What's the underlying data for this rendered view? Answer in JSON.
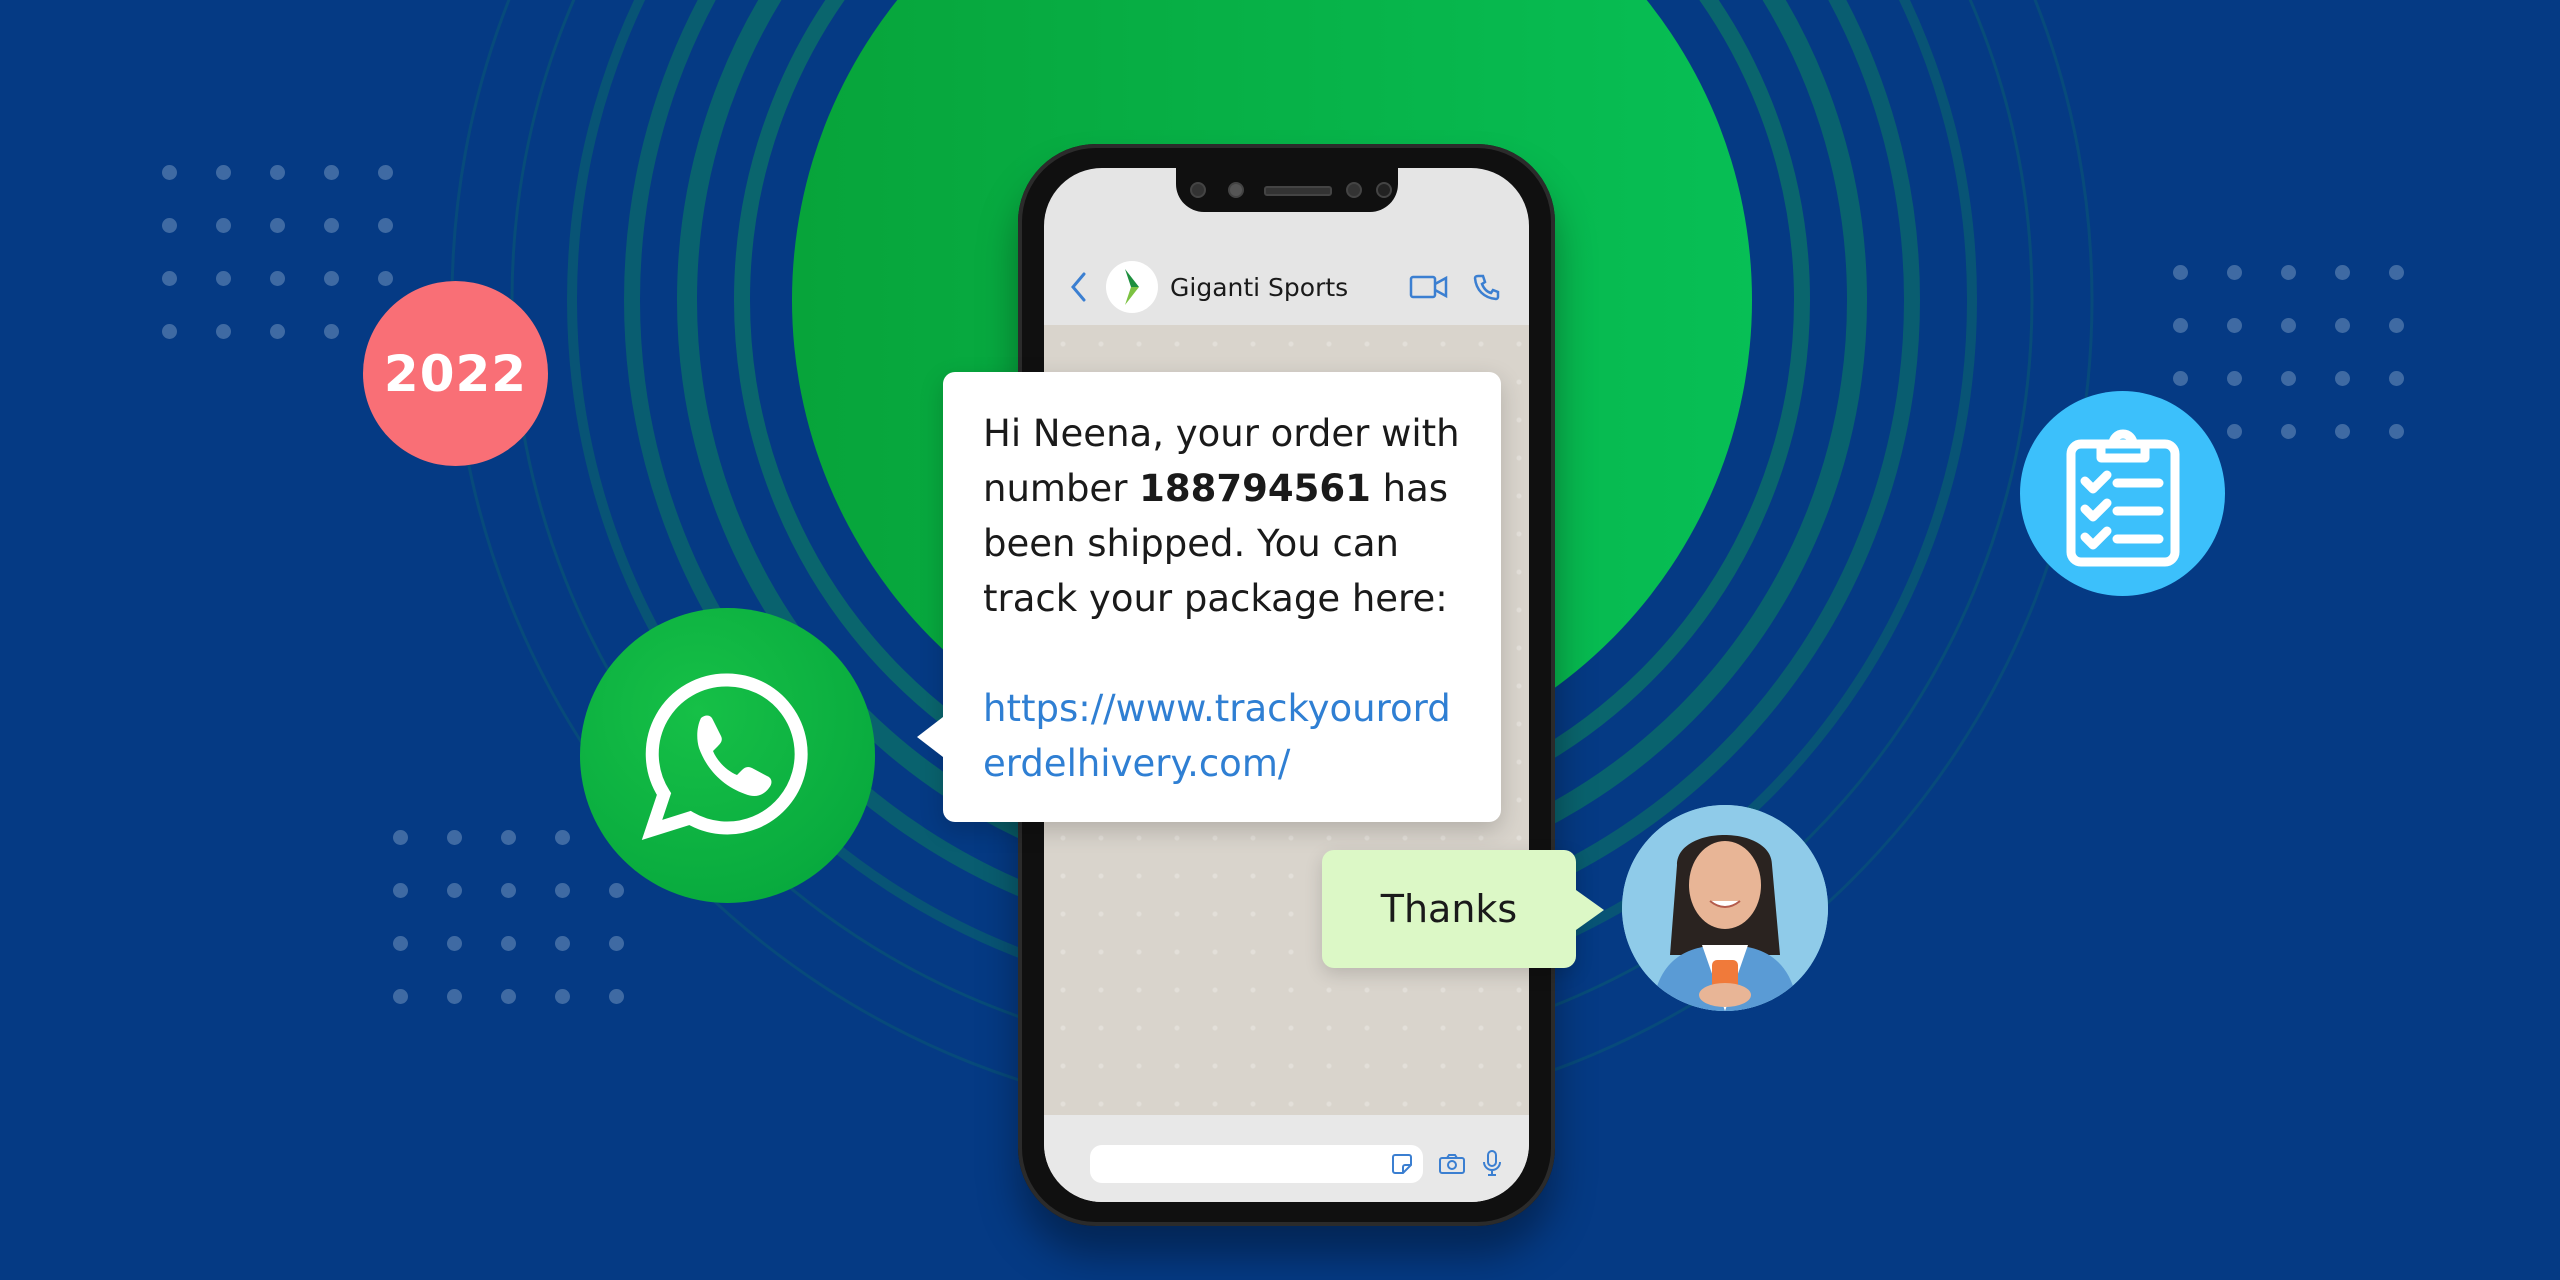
{
  "badges": {
    "year": "2022",
    "clipboard_icon": "clipboard-checklist-icon",
    "whatsapp_icon": "whatsapp-logo-icon"
  },
  "chat": {
    "header": {
      "back_icon": "chevron-left-icon",
      "contact_name": "Giganti Sports",
      "contact_logo": "giganti-sports-logo",
      "video_icon": "video-call-icon",
      "call_icon": "phone-call-icon"
    },
    "incoming_message": {
      "text_before": "Hi Neena, your order with number ",
      "order_number": "188794561",
      "text_after": " has been shipped. You can track your package here:",
      "link": "https://www.trackyourorderdelhivery.com/"
    },
    "outgoing_message": {
      "text": "Thanks"
    },
    "composer": {
      "input_value": "",
      "sticker_icon": "sticker-icon",
      "camera_icon": "camera-icon",
      "mic_icon": "microphone-icon"
    }
  },
  "colors": {
    "background": "#053a84",
    "green_circle": "#06b548",
    "year_badge": "#f96f76",
    "clipboard_badge": "#3cc0fb",
    "link": "#2f7fd3",
    "outgoing_bubble": "#dcf8c6",
    "icon_blue": "#3b7fd1"
  }
}
